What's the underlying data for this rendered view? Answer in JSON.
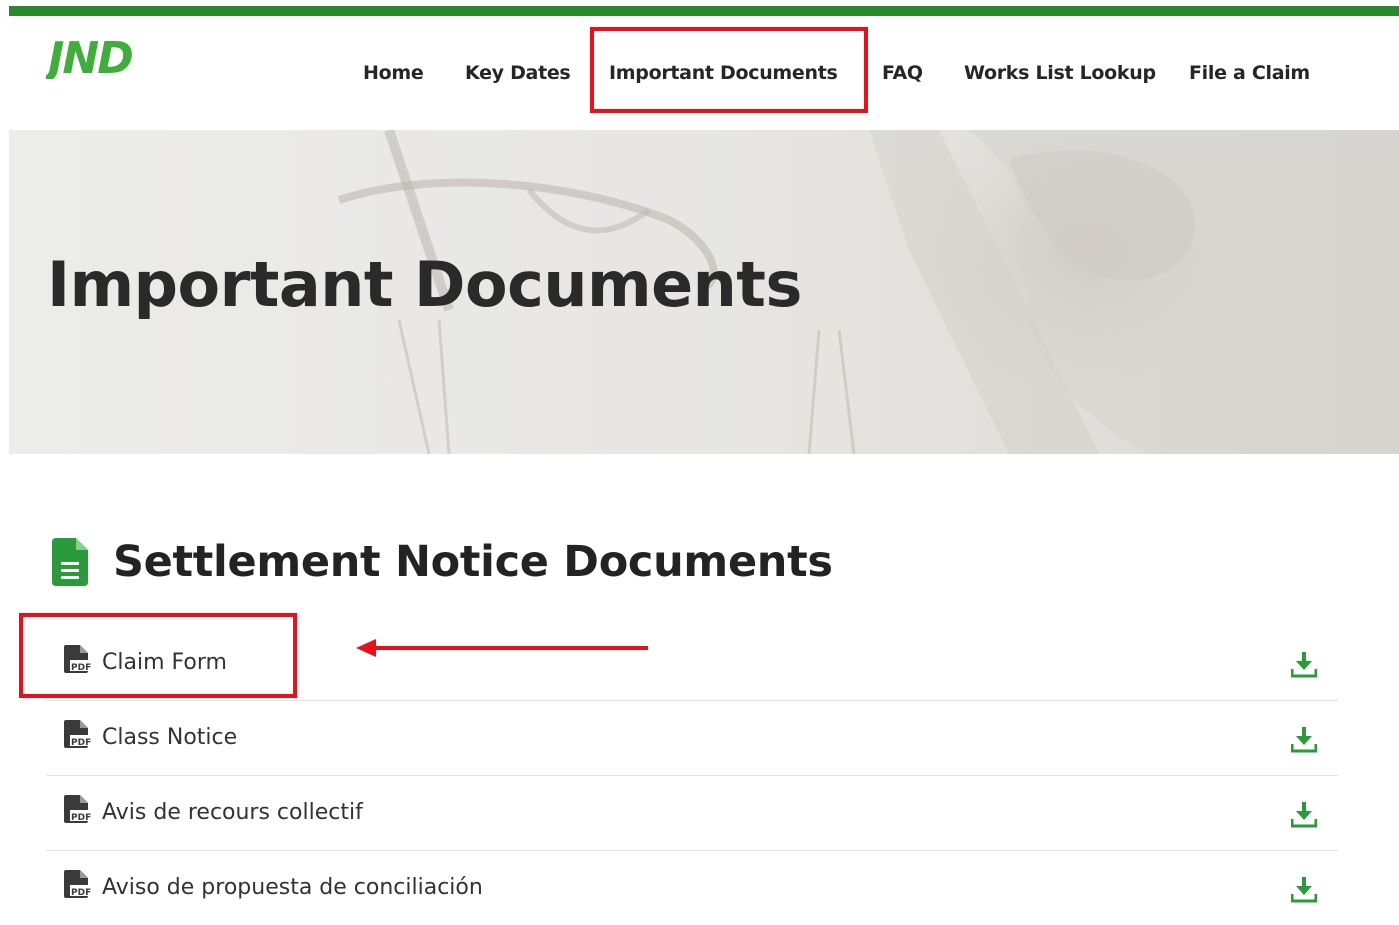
{
  "brand": {
    "logo_text": "JND",
    "accent_color": "#2a8a2a",
    "logo_color": "#3fae3a",
    "highlight_color": "#e8101a"
  },
  "nav": {
    "items": [
      {
        "label": "Home"
      },
      {
        "label": "Key Dates"
      },
      {
        "label": "Important Documents"
      },
      {
        "label": "FAQ"
      },
      {
        "label": "Works List Lookup"
      },
      {
        "label": "File a Claim"
      }
    ]
  },
  "hero": {
    "title": "Important Documents"
  },
  "section": {
    "title": "Settlement Notice Documents",
    "icon": "file-document-icon"
  },
  "documents": [
    {
      "label": "Claim Form",
      "icon": "pdf-file-icon",
      "action_icon": "download-icon"
    },
    {
      "label": "Class Notice",
      "icon": "pdf-file-icon",
      "action_icon": "download-icon"
    },
    {
      "label": "Avis de recours collectif",
      "icon": "pdf-file-icon",
      "action_icon": "download-icon"
    },
    {
      "label": "Aviso de propuesta de conciliación",
      "icon": "pdf-file-icon",
      "action_icon": "download-icon"
    }
  ]
}
